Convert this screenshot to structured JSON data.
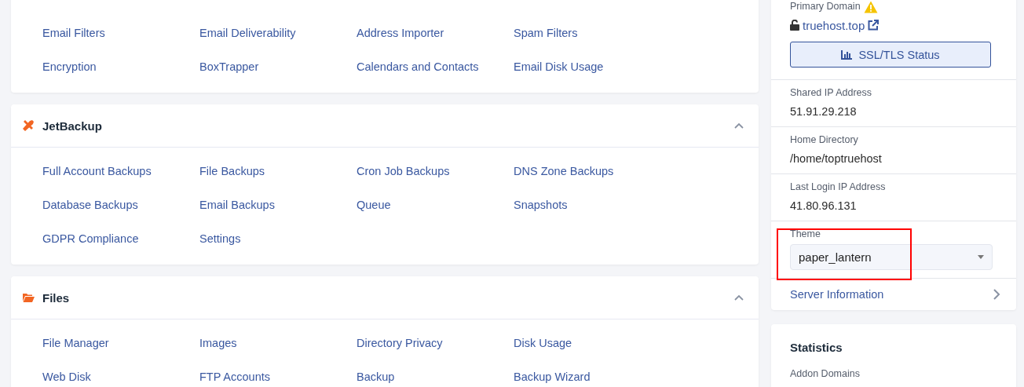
{
  "sections": [
    {
      "kind": "plain",
      "items": [
        "Email Filters",
        "Email Deliverability",
        "Address Importer",
        "Spam Filters",
        "Encryption",
        "BoxTrapper",
        "Calendars and Contacts",
        "Email Disk Usage"
      ]
    },
    {
      "kind": "tools",
      "title": "JetBackup",
      "expanded": true,
      "items": [
        "Full Account Backups",
        "File Backups",
        "Cron Job Backups",
        "DNS Zone Backups",
        "Database Backups",
        "Email Backups",
        "Queue",
        "Snapshots",
        "GDPR Compliance",
        "Settings"
      ]
    },
    {
      "kind": "folder",
      "title": "Files",
      "expanded": true,
      "items": [
        "File Manager",
        "Images",
        "Directory Privacy",
        "Disk Usage",
        "Web Disk",
        "FTP Accounts",
        "Backup",
        "Backup Wizard"
      ]
    }
  ],
  "account_info": {
    "primary_domain": {
      "label": "Primary Domain",
      "domain": "truehost.top",
      "ssl_button": "SSL/TLS Status"
    },
    "fields": [
      {
        "label": "Shared IP Address",
        "value": "51.91.29.218"
      },
      {
        "label": "Home Directory",
        "value": "/home/toptruehost"
      },
      {
        "label": "Last Login IP Address",
        "value": "41.80.96.131"
      }
    ],
    "theme": {
      "label": "Theme",
      "value": "paper_lantern",
      "highlighted": true
    },
    "server_information": "Server Information"
  },
  "statistics": {
    "title": "Statistics",
    "items": [
      "Addon Domains"
    ]
  }
}
